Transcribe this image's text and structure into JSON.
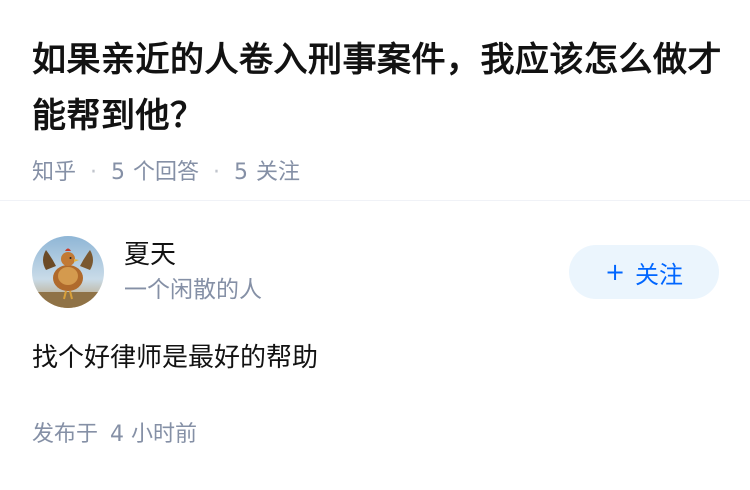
{
  "question": {
    "title": "如果亲近的人卷入刑事案件，我应该怎么做才能帮到他？",
    "source": "知乎",
    "answers_count": "5",
    "answers_label": "个回答",
    "followers_count": "5",
    "followers_label": "关注"
  },
  "answer": {
    "author_name": "夏天",
    "author_bio": "一个闲散的人",
    "follow_label": "关注",
    "follow_icon": "plus-icon",
    "content": "找个好律师是最好的帮助",
    "publish_label": "发布于",
    "publish_time": "4 小时前"
  },
  "colors": {
    "text_primary": "#121212",
    "text_secondary": "#8590a6",
    "accent": "#0066ff",
    "follow_bg": "#ebf5fd",
    "divider": "#f0f2f7"
  }
}
